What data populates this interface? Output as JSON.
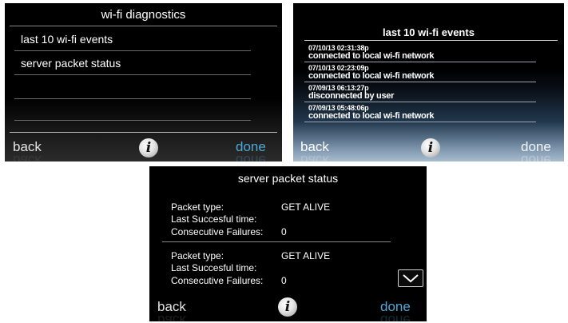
{
  "wifi_diagnostics": {
    "title": "wi-fi diagnostics",
    "items": [
      {
        "label": "last 10 wi-fi events"
      },
      {
        "label": "server packet status"
      }
    ],
    "footer": {
      "back": "back",
      "info": "i",
      "done": "done"
    }
  },
  "wifi_events": {
    "title": "last 10 wi-fi events",
    "events": [
      {
        "timestamp": "07/10/13 02:31:38p",
        "message": "connected to local wi-fi network"
      },
      {
        "timestamp": "07/10/13 02:23:09p",
        "message": "connected to local wi-fi network"
      },
      {
        "timestamp": "07/09/13 06:13:27p",
        "message": "disconnected by user"
      },
      {
        "timestamp": "07/09/13 05:48:06p",
        "message": "connected to local wi-fi network"
      }
    ],
    "footer": {
      "back": "back",
      "info": "i",
      "done": "done"
    }
  },
  "server_packet_status": {
    "title": "server packet status",
    "labels": {
      "packet_type": "Packet type:",
      "last_successful_time": "Last Succesful time:",
      "consecutive_failures": "Consecutive Failures:"
    },
    "packets": [
      {
        "packet_type": "GET ALIVE",
        "last_successful_time": "",
        "consecutive_failures": "0"
      },
      {
        "packet_type": "GET ALIVE",
        "last_successful_time": "",
        "consecutive_failures": "0"
      }
    ],
    "scroll_icon": "chevron-down-icon",
    "footer": {
      "back": "back",
      "info": "i",
      "done": "done"
    }
  },
  "colors": {
    "done_accent": "#4fa8d8",
    "screen_background": "#000000",
    "text": "#ffffff"
  }
}
